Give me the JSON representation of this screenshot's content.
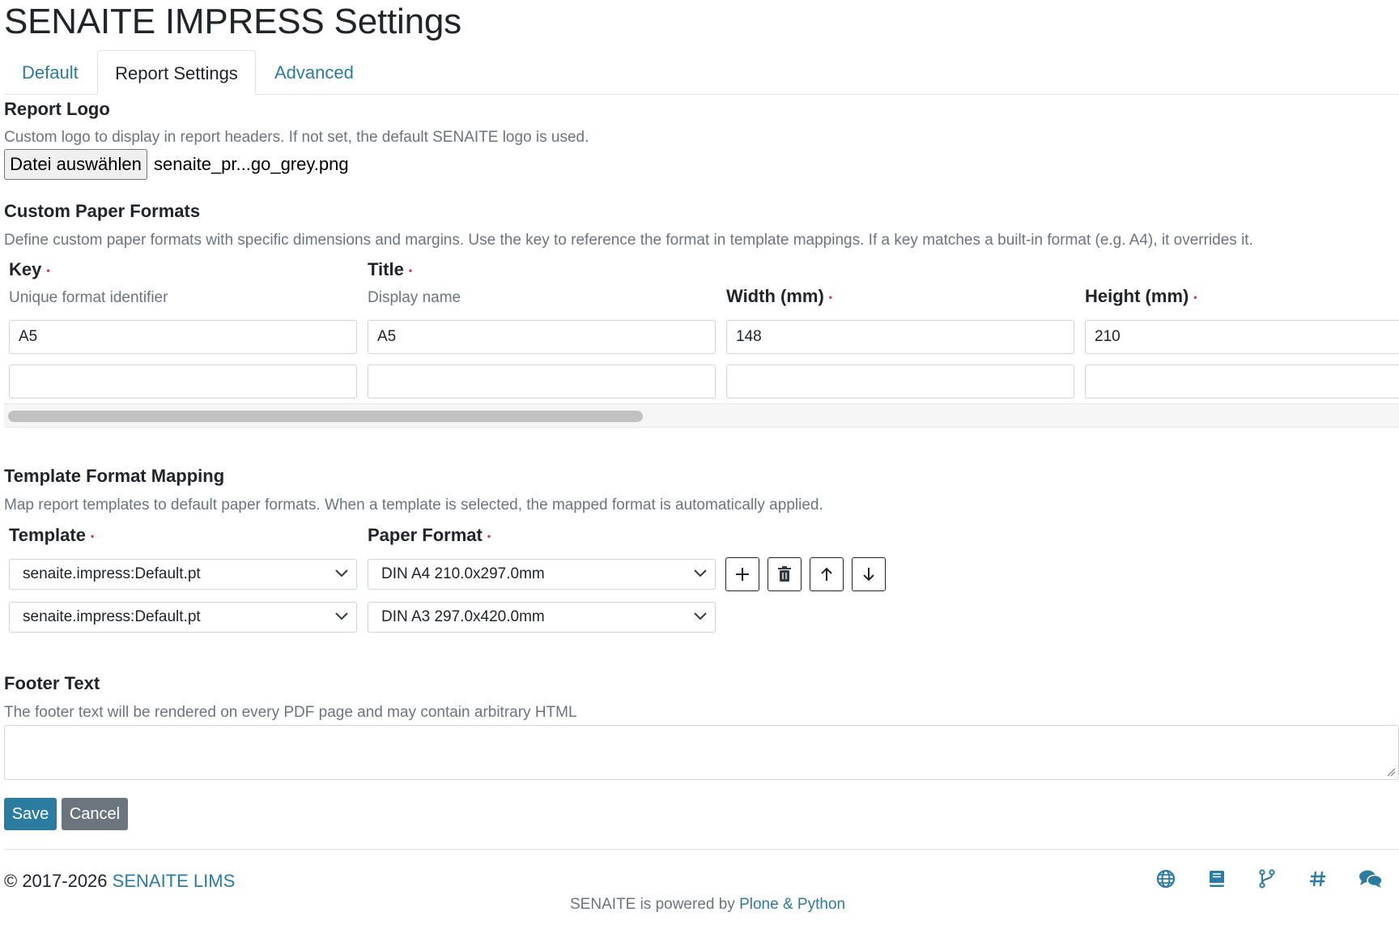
{
  "page": {
    "title": "SENAITE IMPRESS Settings"
  },
  "tabs": [
    {
      "label": "Default",
      "active": false
    },
    {
      "label": "Report Settings",
      "active": true
    },
    {
      "label": "Advanced",
      "active": false
    }
  ],
  "report_logo": {
    "title": "Report Logo",
    "help": "Custom logo to display in report headers. If not set, the default SENAITE logo is used.",
    "button_label": "Datei auswählen",
    "file_name": "senaite_pr...go_grey.png"
  },
  "paper_formats": {
    "title": "Custom Paper Formats",
    "help": "Define custom paper formats with specific dimensions and margins. Use the key to reference the format in template mappings. If a key matches a built-in format (e.g. A4), it overrides it.",
    "columns": [
      {
        "label": "Key",
        "help": "Unique format identifier"
      },
      {
        "label": "Title",
        "help": "Display name"
      },
      {
        "label": "Width (mm)",
        "help": ""
      },
      {
        "label": "Height (mm)",
        "help": ""
      }
    ],
    "rows": [
      {
        "key": "A5",
        "title": "A5",
        "width": "148",
        "height": "210"
      },
      {
        "key": "",
        "title": "",
        "width": "",
        "height": ""
      }
    ],
    "required_marker": "•"
  },
  "template_mapping": {
    "title": "Template Format Mapping",
    "help": "Map report templates to default paper formats. When a template is selected, the mapped format is automatically applied.",
    "columns": [
      {
        "label": "Template"
      },
      {
        "label": "Paper Format"
      }
    ],
    "rows": [
      {
        "template": "senaite.impress:Default.pt",
        "format": "DIN A4 210.0x297.0mm"
      },
      {
        "template": "senaite.impress:Default.pt",
        "format": "DIN A3 297.0x420.0mm"
      }
    ],
    "row_actions": [
      "plus-icon",
      "trash-icon",
      "arrow-up-icon",
      "arrow-down-icon"
    ]
  },
  "footer_text": {
    "title": "Footer Text",
    "help": "The footer text will be rendered on every PDF page and may contain arbitrary HTML",
    "value": ""
  },
  "actions": {
    "save": "Save",
    "cancel": "Cancel"
  },
  "footer": {
    "copyright_prefix": "© 2017-2026 ",
    "copyright_link": "SENAITE LIMS",
    "powered_prefix": "SENAITE is powered by ",
    "powered_link": "Plone & Python",
    "icons": [
      "globe-icon",
      "book-icon",
      "code-branch-icon",
      "hashtag-icon",
      "comments-icon"
    ]
  },
  "colors": {
    "accent": "#2c7ba0",
    "text": "#212529",
    "muted": "#6c757d",
    "required": "#dc3545",
    "cancel": "#6c757d"
  }
}
